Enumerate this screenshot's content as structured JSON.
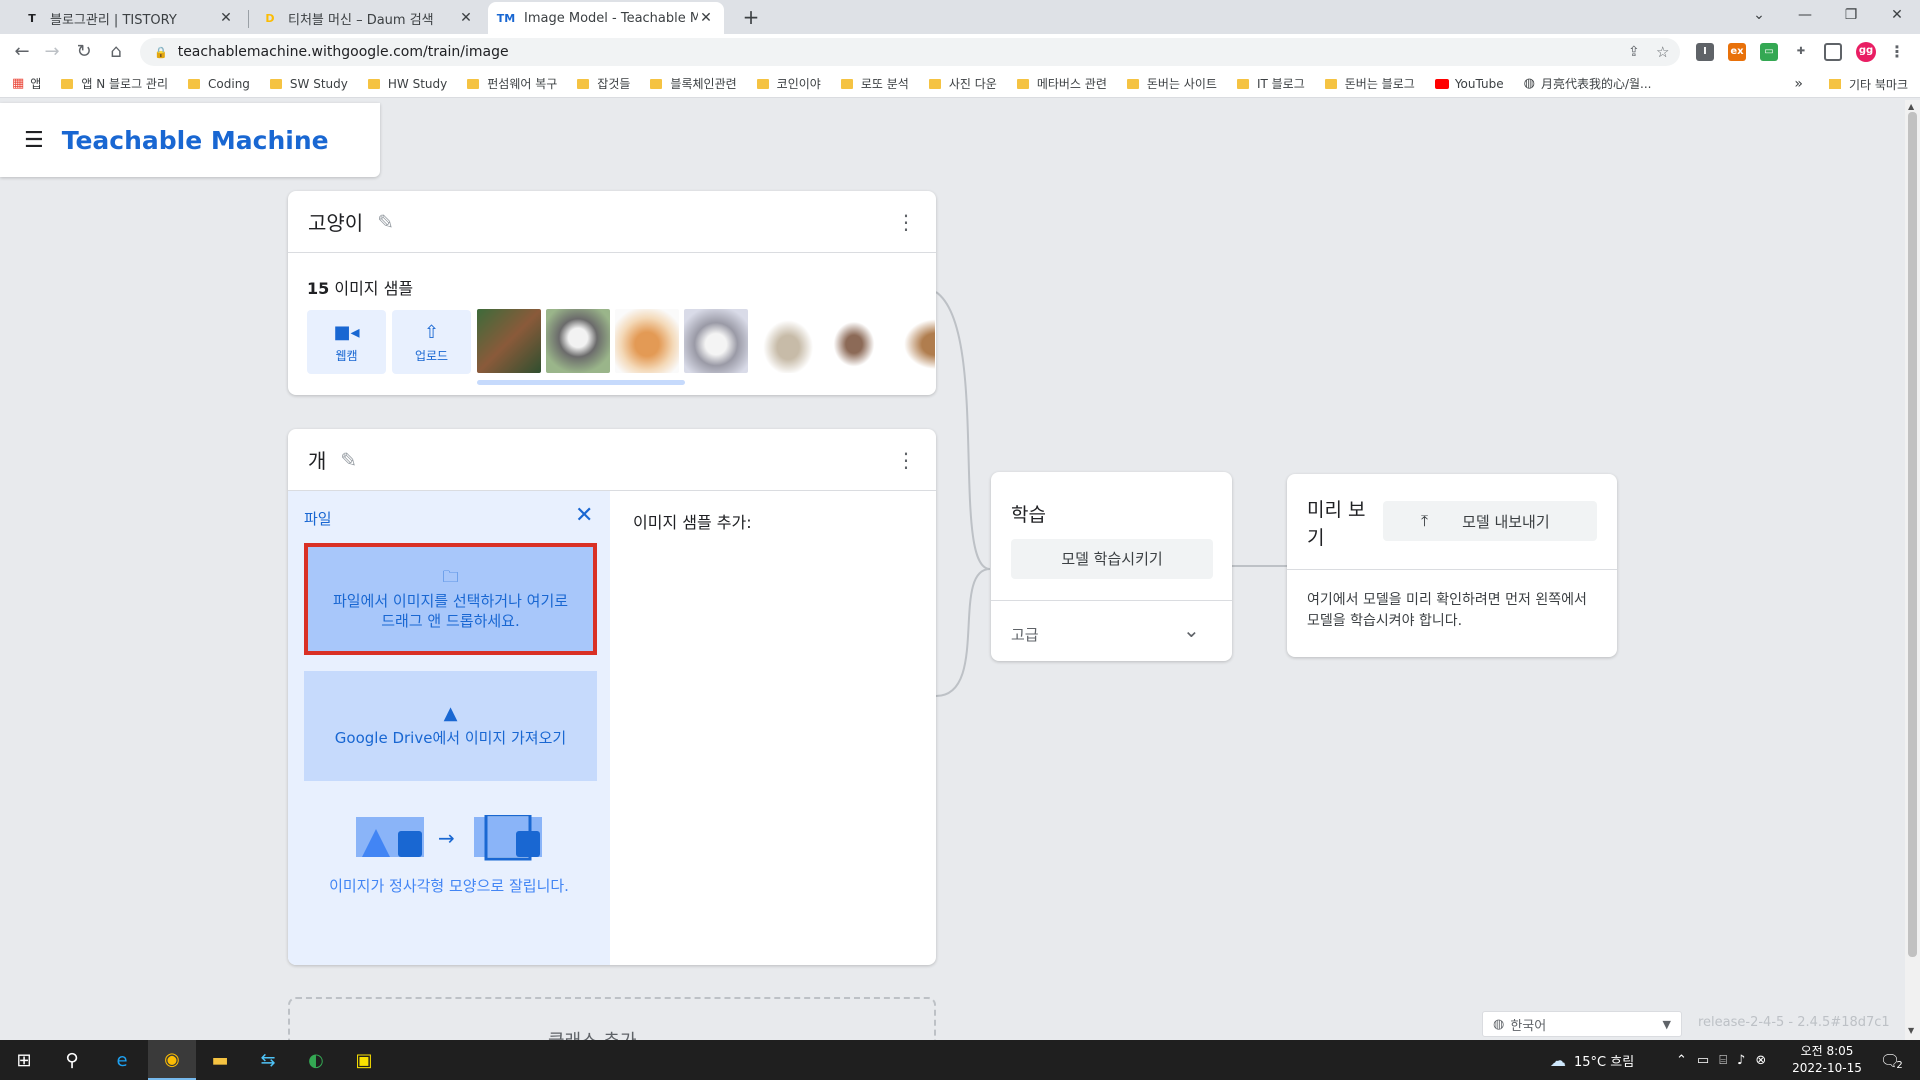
{
  "browser": {
    "tabs": [
      {
        "title": "블로그관리 | TISTORY",
        "favicon": "T",
        "favicon_color": "#202124"
      },
      {
        "title": "티처블 머신 – Daum 검색",
        "favicon": "D",
        "favicon_color": "#fbbc04"
      },
      {
        "title": "Image Model - Teachable Mach",
        "favicon": "TM",
        "favicon_color": "#1967d2"
      }
    ],
    "new_tab_label": "+",
    "url": "teachablemachine.withgoogle.com/train/image",
    "profile_initials": "gg",
    "bookmarks": [
      "앱",
      "앱 N 블로그 관리",
      "Coding",
      "SW Study",
      "HW Study",
      "펀섬웨어 복구",
      "잡것들",
      "블록체인관련",
      "코인이야",
      "로또 분석",
      "사진 다운",
      "메타버스 관련",
      "돈버는 사이트",
      "IT 블로그",
      "돈버는 블로그",
      "YouTube",
      "月亮代表我的心/월..."
    ],
    "bookmarks_overflow": "»",
    "other_bookmarks": "기타 북마크"
  },
  "app": {
    "brand": "Teachable Machine"
  },
  "class1": {
    "name": "고양이",
    "sample_count": "15",
    "sample_label": "이미지 샘플",
    "webcam_label": "웹캠",
    "upload_label": "업로드"
  },
  "class2": {
    "name": "개",
    "file_title": "파일",
    "drop_text": "파일에서 이미지를 선택하거나 여기로 드래그 앤 드롭하세요.",
    "drive_text": "Google Drive에서 이미지 가져오기",
    "crop_note": "이미지가 정사각형 모양으로 잘립니다.",
    "add_samples": "이미지 샘플 추가:"
  },
  "add_class_label": "클래스 추가",
  "training": {
    "title": "학습",
    "train_button": "모델 학습시키기",
    "advanced": "고급"
  },
  "preview": {
    "title": "미리 보기",
    "export_button": "모델 내보내기",
    "message": "여기에서 모델을 미리 확인하려면 먼저 왼쪽에서 모델을 학습시켜야 합니다."
  },
  "footer": {
    "language": "한국어",
    "release": "release-2-4-5 - 2.4.5#18d7c1"
  },
  "taskbar": {
    "weather": "15°C 흐림",
    "time": "오전 8:05",
    "date": "2022-10-15",
    "notifications": "2"
  },
  "colors": {
    "brand_blue": "#1967d2",
    "highlight_red": "#d93025",
    "pane_bg": "#e8f0fe"
  }
}
